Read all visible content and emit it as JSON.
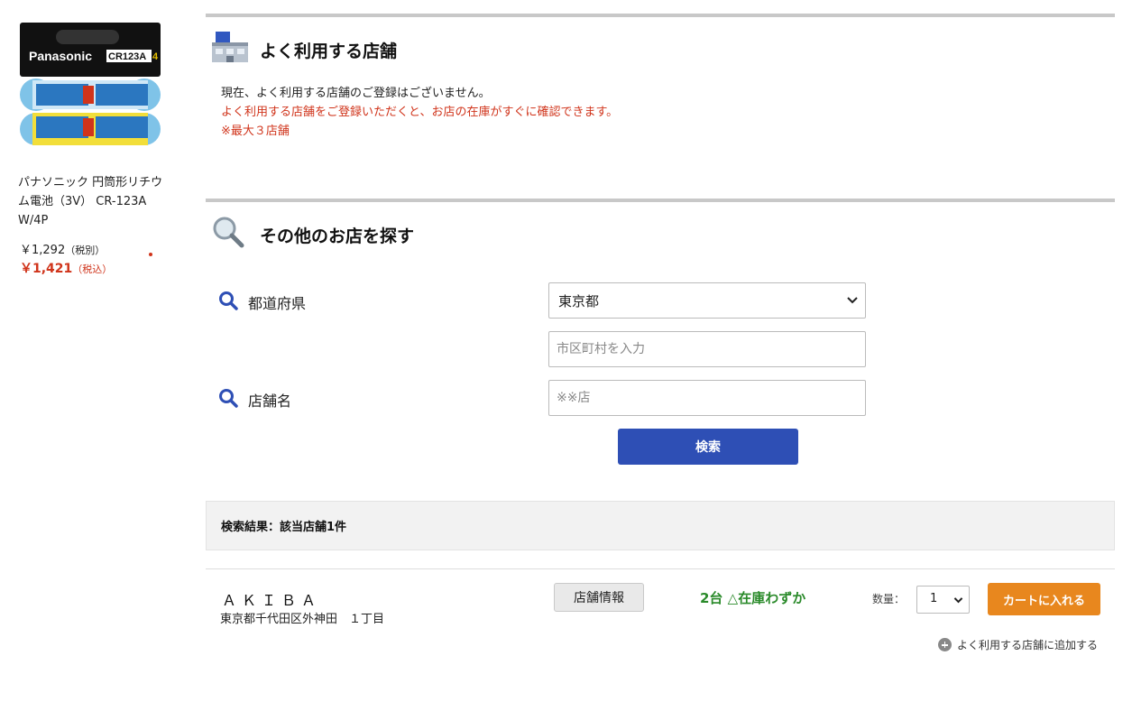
{
  "product": {
    "image_alt": "Panasonic CR123A",
    "brand_label": "Panasonic",
    "model_label": "CR123A",
    "count_label": "4",
    "name": "パナソニック 円筒形リチウム電池（3V） CR-123A W/4P",
    "price_ex_value": "￥1,292",
    "price_ex_note": "（税別）",
    "price_in_value": "￥1,421",
    "price_in_note": "（税込）"
  },
  "favorite_stores": {
    "title": "よく利用する店舗",
    "message_none": "現在、よく利用する店舗のご登録はございません。",
    "message_hint": "よく利用する店舗をご登録いただくと、お店の在庫がすぐに確認できます。",
    "message_limit": "※最大３店舗"
  },
  "other_stores": {
    "title": "その他のお店を探す",
    "prefecture_label": "都道府県",
    "prefecture_value": "東京都",
    "city_placeholder": "市区町村を入力",
    "store_label": "店舗名",
    "store_placeholder": "※※店",
    "search_button": "検索"
  },
  "results": {
    "summary": "検索結果：該当店舗1件",
    "stores": [
      {
        "name": "ＡＫＩＢＡ",
        "address": "東京都千代田区外神田　１丁目",
        "info_button": "店舗情報",
        "stock": "2台 △在庫わずか",
        "qty_label": "数量：",
        "qty_value": "1",
        "cart_button": "カートに入れる",
        "add_favorite": "よく利用する店舗に追加する"
      }
    ]
  },
  "colors": {
    "accent_blue": "#2e4fb5",
    "cart_orange": "#e8871e",
    "alert_red": "#d0341b",
    "stock_green": "#2a8a2a"
  }
}
